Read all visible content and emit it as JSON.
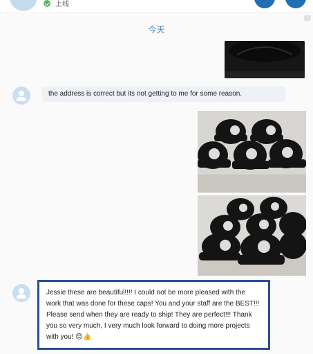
{
  "header": {
    "status_text": "上线",
    "status_color": "#5bb56a",
    "button_color": "#1e6fb5"
  },
  "chat": {
    "date_separator": "今天",
    "messages": [
      {
        "type": "image",
        "direction": "outgoing",
        "description_icon": "cap-photo"
      },
      {
        "type": "text",
        "direction": "incoming",
        "text": "the address is correct but its not getting to me for some reason."
      },
      {
        "type": "image",
        "direction": "outgoing",
        "description_icon": "cap-photo"
      },
      {
        "type": "image",
        "direction": "outgoing",
        "description_icon": "cap-photo"
      },
      {
        "type": "text",
        "direction": "incoming",
        "text": "Jessie these are beautiful!!!! I could not be more pleased with the work that was done for these caps! You and your staff are the BEST!!! Please send when they are ready to ship! They are perfect!!! Thank you so very much, I very much look forward to doing more projects with you! 😊👍"
      }
    ]
  },
  "colors": {
    "highlight_border": "#2a4f96",
    "incoming_bubble": "#eef2f6",
    "date_text": "#4a7fb3"
  }
}
